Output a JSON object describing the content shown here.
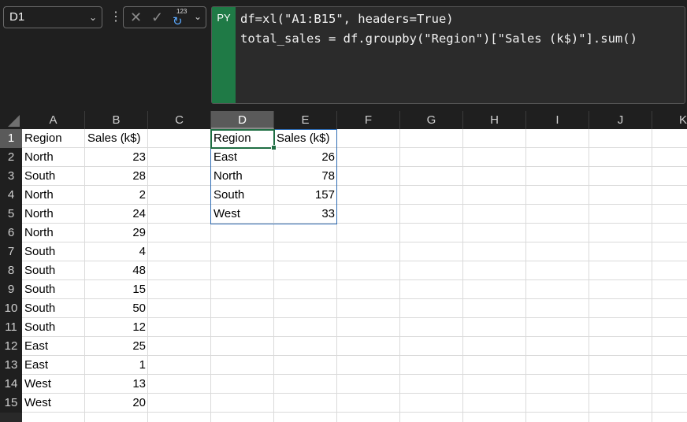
{
  "namebox": {
    "value": "D1"
  },
  "formula": {
    "tag": "PY",
    "line1": "df=xl(\"A1:B15\", headers=True)",
    "line2": "total_sales = df.groupby(\"Region\")[\"Sales (k$)\"].sum()",
    "py_number": "123"
  },
  "columns": [
    "A",
    "B",
    "C",
    "D",
    "E",
    "F",
    "G",
    "H",
    "I",
    "J",
    "K"
  ],
  "rows": [
    "1",
    "2",
    "3",
    "4",
    "5",
    "6",
    "7",
    "8",
    "9",
    "10",
    "11",
    "12",
    "13",
    "14",
    "15"
  ],
  "source_table": {
    "headers": [
      "Region",
      "Sales (k$)"
    ],
    "rows": [
      [
        "North",
        "23"
      ],
      [
        "South",
        "28"
      ],
      [
        "North",
        "2"
      ],
      [
        "North",
        "24"
      ],
      [
        "North",
        "29"
      ],
      [
        "South",
        "4"
      ],
      [
        "South",
        "48"
      ],
      [
        "South",
        "15"
      ],
      [
        "South",
        "50"
      ],
      [
        "South",
        "12"
      ],
      [
        "East",
        "25"
      ],
      [
        "East",
        "1"
      ],
      [
        "West",
        "13"
      ],
      [
        "West",
        "20"
      ]
    ]
  },
  "result_table": {
    "headers": [
      "Region",
      "Sales (k$)"
    ],
    "rows": [
      [
        "East",
        "26"
      ],
      [
        "North",
        "78"
      ],
      [
        "South",
        "157"
      ],
      [
        "West",
        "33"
      ]
    ]
  },
  "colors": {
    "accent_green": "#1f7a46",
    "selection_blue": "#2f6db5"
  }
}
